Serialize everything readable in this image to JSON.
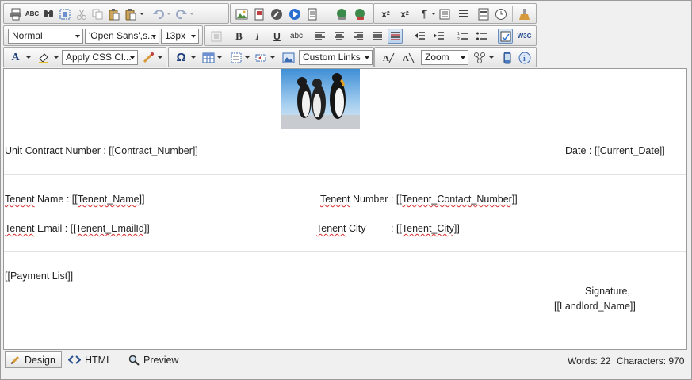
{
  "toolbar1": {
    "buttons": [
      "print-icon",
      "spellcheck-icon",
      "find-icon",
      "select-all-icon",
      "cut-icon",
      "copy-icon",
      "paste-icon",
      "paste-options-icon",
      "undo-icon",
      "redo-icon",
      "image-icon",
      "image-map-icon",
      "flash-icon",
      "media-icon",
      "document-icon",
      "link-icon",
      "unlink-icon",
      "superscript-icon",
      "subscript-icon",
      "paragraph-icon",
      "form-icon",
      "list-icon",
      "template-icon",
      "clock-icon",
      "clean-icon"
    ]
  },
  "toolbar2": {
    "format_block": "Normal",
    "font_name": "'Open Sans',s...",
    "font_size": "13px",
    "bold": "B",
    "italic": "I",
    "underline": "U",
    "strike": "abc"
  },
  "toolbar3": {
    "css_class": "Apply CSS Cl...",
    "omega": "Ω",
    "custom_links": "Custom Links",
    "zoom": "Zoom"
  },
  "content": {
    "contract_label": "Unit Contract Number : ",
    "contract_value": "[[Contract_Number]]",
    "date_label": "Date : ",
    "date_value": "[[Current_Date]]",
    "tenent_name_label_a": "Tenent",
    "tenent_name_label_b": " Name : ",
    "tenent_name_value": "[[Tenent_Name]]",
    "tenent_number_label_a": "Tenent",
    "tenent_number_label_b": " Number :  ",
    "tenent_number_value": "[[Tenent_Contact_Number]]",
    "tenent_email_label_a": "Tenent",
    "tenent_email_label_b": " Email  : ",
    "tenent_email_value": "[[Tenent_EmailId]]",
    "tenent_city_label_a": "Tenent",
    "tenent_city_label_b": " City",
    "tenent_city_colon": ":  ",
    "tenent_city_value": "[[Tenent_City]]",
    "payment_list": "[[Payment List]]",
    "signature": "Signature,",
    "landlord": "[[Landlord_Name]]"
  },
  "statusbar": {
    "design": "Design",
    "html": "HTML",
    "preview": "Preview",
    "words_label": "Words: ",
    "words": "22",
    "chars_label": "Characters: ",
    "chars": "970"
  }
}
